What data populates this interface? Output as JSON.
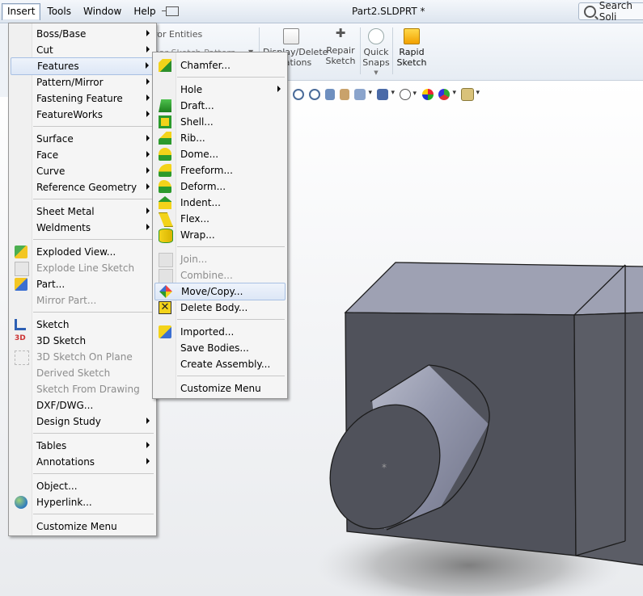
{
  "menubar": {
    "items": [
      {
        "label": "Insert"
      },
      {
        "label": "Tools"
      },
      {
        "label": "Window"
      },
      {
        "label": "Help"
      }
    ]
  },
  "window": {
    "title": "Part2.SLDPRT *"
  },
  "search": {
    "label": "Search Soli"
  },
  "cmd": {
    "mirror_entities": "ror Entities",
    "linear_pattern": "ear Sketch Pattern",
    "display_delete_1": "Display/Delete",
    "display_delete_2": "Relations",
    "repair_1": "Repair",
    "repair_2": "Sketch",
    "quick_1": "Quick",
    "quick_2": "Snaps",
    "rapid_1": "Rapid",
    "rapid_2": "Sketch"
  },
  "insert_menu": {
    "items": [
      {
        "label": "Boss/Base"
      },
      {
        "label": "Cut"
      },
      {
        "label": "Features"
      },
      {
        "label": "Pattern/Mirror"
      },
      {
        "label": "Fastening Feature"
      },
      {
        "label": "FeatureWorks"
      },
      {
        "label": "Surface"
      },
      {
        "label": "Face"
      },
      {
        "label": "Curve"
      },
      {
        "label": "Reference Geometry"
      },
      {
        "label": "Sheet Metal"
      },
      {
        "label": "Weldments"
      },
      {
        "label": "Exploded View..."
      },
      {
        "label": "Explode Line Sketch"
      },
      {
        "label": "Part..."
      },
      {
        "label": "Mirror Part..."
      },
      {
        "label": "Sketch"
      },
      {
        "label": "3D Sketch"
      },
      {
        "label": "3D Sketch On Plane"
      },
      {
        "label": "Derived Sketch"
      },
      {
        "label": "Sketch From Drawing"
      },
      {
        "label": "DXF/DWG..."
      },
      {
        "label": "Design Study"
      },
      {
        "label": "Tables"
      },
      {
        "label": "Annotations"
      },
      {
        "label": "Object..."
      },
      {
        "label": "Hyperlink..."
      },
      {
        "label": "Customize Menu"
      }
    ]
  },
  "features_menu": {
    "items": [
      {
        "label": "Chamfer..."
      },
      {
        "label": "Hole"
      },
      {
        "label": "Draft..."
      },
      {
        "label": "Shell..."
      },
      {
        "label": "Rib..."
      },
      {
        "label": "Dome..."
      },
      {
        "label": "Freeform..."
      },
      {
        "label": "Deform..."
      },
      {
        "label": "Indent..."
      },
      {
        "label": "Flex..."
      },
      {
        "label": "Wrap..."
      },
      {
        "label": "Join..."
      },
      {
        "label": "Combine..."
      },
      {
        "label": "Move/Copy..."
      },
      {
        "label": "Delete Body..."
      },
      {
        "label": "Imported..."
      },
      {
        "label": "Save Bodies..."
      },
      {
        "label": "Create Assembly..."
      },
      {
        "label": "Customize Menu"
      }
    ]
  },
  "colors": {
    "menu_highlight": "#dde7f6",
    "box_front": "#50525b",
    "box_top": "#9ea1b3",
    "cylinder": "#9094a8"
  }
}
